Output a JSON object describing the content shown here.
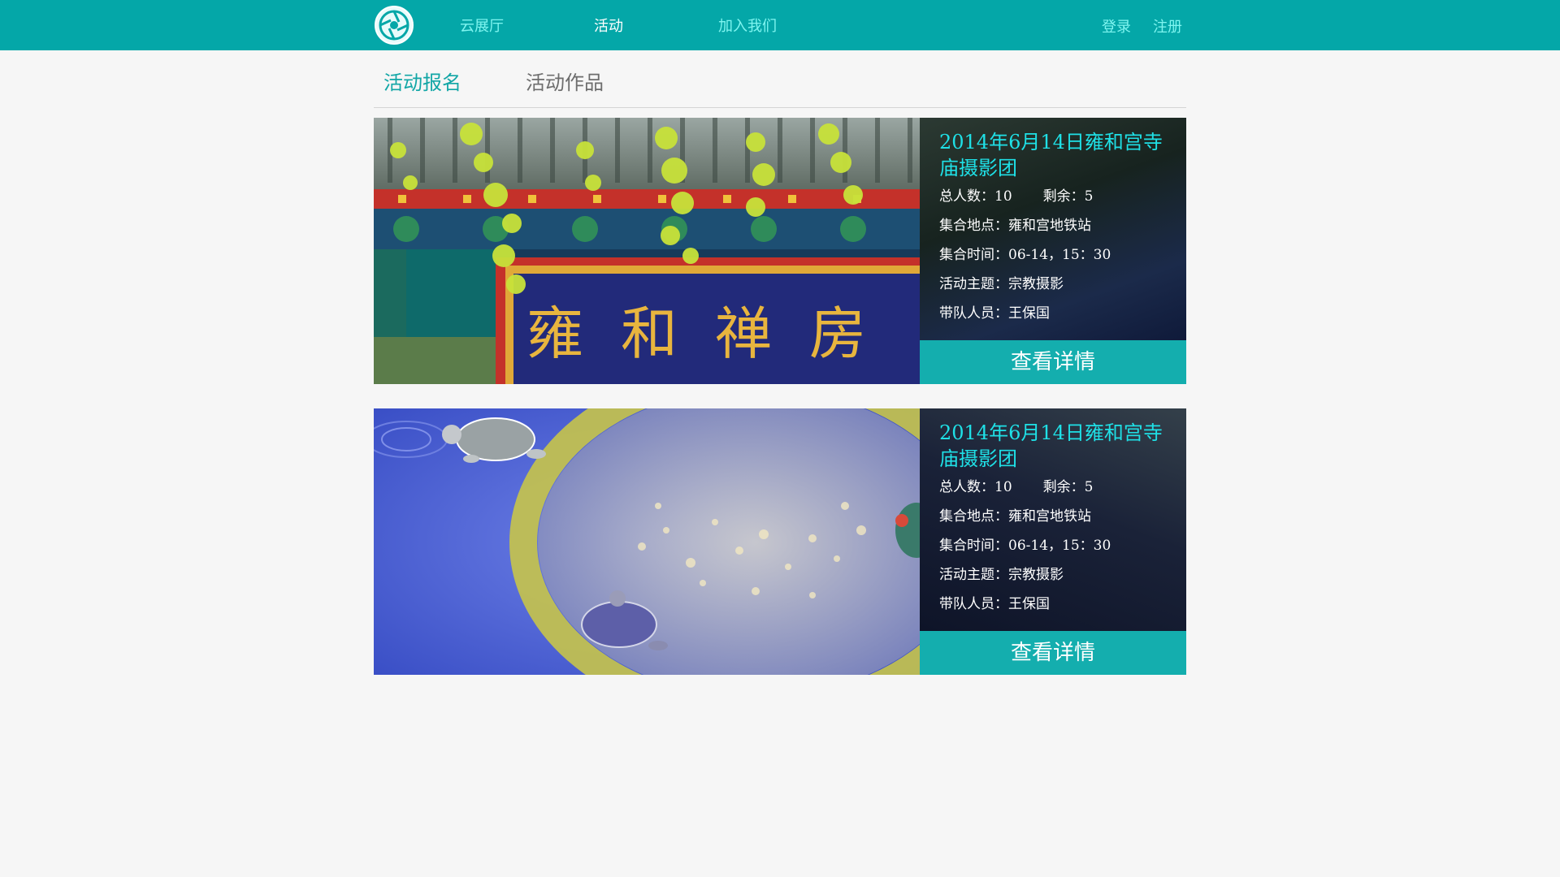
{
  "nav": {
    "items": [
      {
        "label": "云展厅"
      },
      {
        "label": "活动"
      },
      {
        "label": "加入我们"
      }
    ],
    "login": "登录",
    "register": "注册"
  },
  "subtabs": [
    {
      "label": "活动报名",
      "active": true
    },
    {
      "label": "活动作品",
      "active": false
    }
  ],
  "activities": [
    {
      "title": "2014年6月14日雍和宫寺庙摄影团",
      "total_label": "总人数：",
      "total": "10",
      "remaining_label": "剩余：",
      "remaining": "5",
      "location_label": "集合地点：",
      "location": "雍和宫地铁站",
      "time_label": "集合时间：",
      "time": "06-14，15：30",
      "theme_label": "活动主题：",
      "theme": "宗教摄影",
      "leader_label": "带队人员：",
      "leader": "王保国",
      "button": "查看详情",
      "plaque_text": "雍和禅房"
    },
    {
      "title": "2014年6月14日雍和宫寺庙摄影团",
      "total_label": "总人数：",
      "total": "10",
      "remaining_label": "剩余：",
      "remaining": "5",
      "location_label": "集合地点：",
      "location": "雍和宫地铁站",
      "time_label": "集合时间：",
      "time": "06-14，15：30",
      "theme_label": "活动主题：",
      "theme": "宗教摄影",
      "leader_label": "带队人员：",
      "leader": "王保国",
      "button": "查看详情"
    }
  ],
  "colors": {
    "topbar": "#04a7a8",
    "nav_text": "#7ff5f0",
    "accent": "#14aeae",
    "card_title": "#1fe0e6"
  },
  "icons": {
    "logo": "camera-aperture-icon"
  }
}
